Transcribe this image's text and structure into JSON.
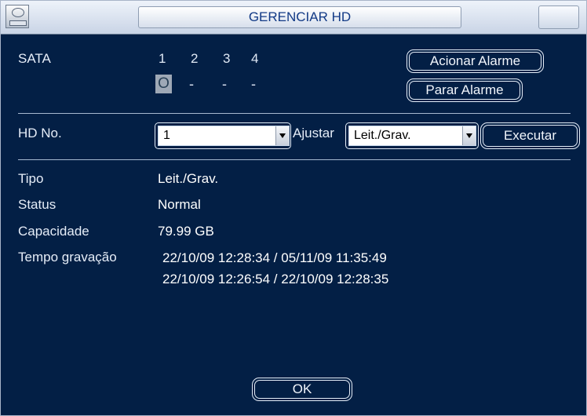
{
  "window": {
    "title": "GERENCIAR HD"
  },
  "sata": {
    "label": "SATA",
    "numbers": [
      "1",
      "2",
      "3",
      "4"
    ],
    "status": [
      "O",
      "-",
      "-",
      "-"
    ],
    "alarm_on_label": "Acionar Alarme",
    "alarm_off_label": "Parar Alarme"
  },
  "hd": {
    "label": "HD No.",
    "selected": "1",
    "adjust_label": "Ajustar",
    "mode_selected": "Leit./Grav.",
    "execute_label": "Executar"
  },
  "info": {
    "type_label": "Tipo",
    "type_value": "Leit./Grav.",
    "status_label": "Status",
    "status_value": "Normal",
    "capacity_label": "Capacidade",
    "capacity_value": "79.99 GB",
    "record_label": "Tempo gravação",
    "record_times": [
      "22/10/09 12:28:34 / 05/11/09 11:35:49",
      "22/10/09 12:26:54 / 22/10/09 12:28:35"
    ]
  },
  "footer": {
    "ok_label": "OK"
  },
  "colors": {
    "background": "#031f45",
    "title_text": "#123a86",
    "text": "#e6edf8"
  }
}
